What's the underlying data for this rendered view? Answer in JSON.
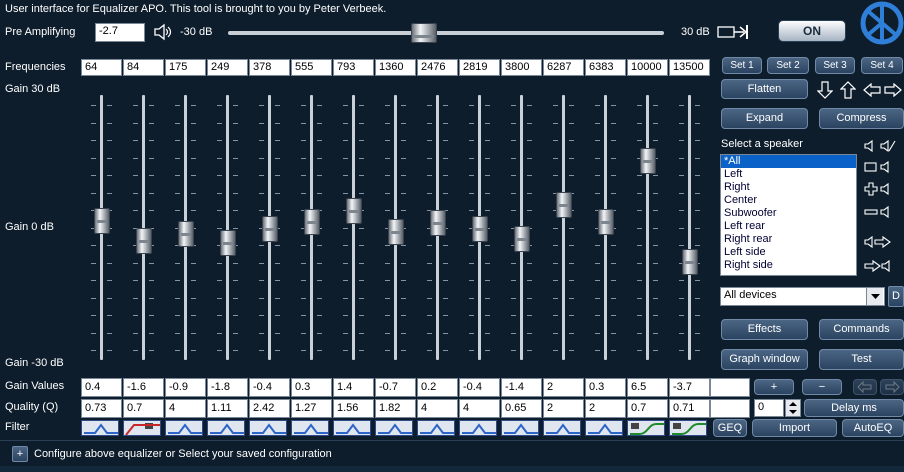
{
  "header": {
    "title": "User interface for Equalizer APO. This tool is brought to you by Peter Verbeek.",
    "on_label": "ON"
  },
  "pre_amp": {
    "label": "Pre Amplifying",
    "value": "-2.7",
    "min_label": "-30 dB",
    "max_label": "30 dB",
    "value_fraction": 0.45
  },
  "labels": {
    "frequencies": "Frequencies",
    "gain_top": "Gain 30 dB",
    "gain_mid": "Gain 0 dB",
    "gain_bottom": "Gain -30 dB",
    "gain_values": "Gain Values",
    "quality": "Quality (Q)",
    "filter": "Filter"
  },
  "frequencies": [
    "64",
    "84",
    "175",
    "249",
    "378",
    "555",
    "793",
    "1360",
    "2476",
    "2819",
    "3800",
    "6287",
    "6383",
    "10000",
    "13500"
  ],
  "gains": [
    "0.4",
    "-1.6",
    "-0.9",
    "-1.8",
    "-0.4",
    "0.3",
    "1.4",
    "-0.7",
    "0.2",
    "-0.4",
    "-1.4",
    "2",
    "0.3",
    "6.5",
    "-3.7"
  ],
  "qualities": [
    "0.73",
    "0.7",
    "4",
    "1.11",
    "2.42",
    "1.27",
    "1.56",
    "1.82",
    "4",
    "4",
    "0.65",
    "2",
    "2",
    "0.7",
    "0.71"
  ],
  "filters": [
    "peak",
    "lowcut",
    "peak",
    "peak",
    "peak",
    "peak",
    "peak",
    "peak",
    "peak",
    "peak",
    "peak",
    "peak",
    "peak",
    "lowshelf",
    "lowshelf"
  ],
  "sets": [
    "Set 1",
    "Set 2",
    "Set 3",
    "Set 4"
  ],
  "buttons": {
    "flatten": "Flatten",
    "expand": "Expand",
    "compress": "Compress",
    "effects": "Effects",
    "commands": "Commands",
    "graph_window": "Graph window",
    "test": "Test",
    "plus": "+",
    "minus": "−",
    "delay": "Delay ms",
    "geq": "GEQ",
    "import": "Import",
    "autoeq": "AutoEQ",
    "device_d": "D"
  },
  "speaker": {
    "label": "Select a speaker",
    "items": [
      "*All",
      "Left",
      "Right",
      "Center",
      "Subwoofer",
      "Left rear",
      "Right rear",
      "Left side",
      "Right side"
    ],
    "selected": 0
  },
  "devices": {
    "value": "All devices"
  },
  "delay_value": "0",
  "footer": {
    "expand": "+",
    "text": "Configure above equalizer or Select your saved configuration"
  }
}
